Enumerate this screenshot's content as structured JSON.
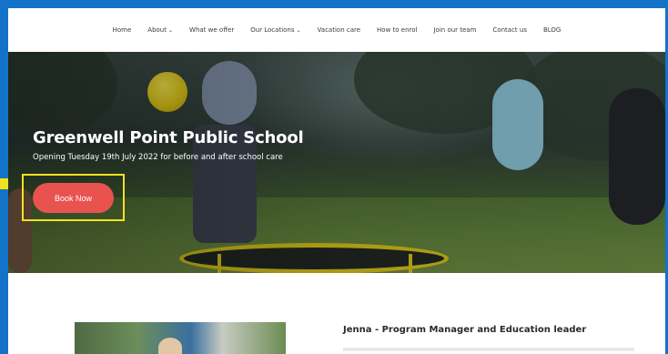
{
  "nav": {
    "items": [
      {
        "label": "Home",
        "dropdown": false
      },
      {
        "label": "About",
        "dropdown": true
      },
      {
        "label": "What we offer",
        "dropdown": false
      },
      {
        "label": "Our Locations",
        "dropdown": true
      },
      {
        "label": "Vacation care",
        "dropdown": false
      },
      {
        "label": "How to enrol",
        "dropdown": false
      },
      {
        "label": "Join our team",
        "dropdown": false
      },
      {
        "label": "Contact us",
        "dropdown": false
      },
      {
        "label": "BLOG",
        "dropdown": false
      }
    ],
    "chevron": "⌄"
  },
  "hero": {
    "title": "Greenwell Point Public School",
    "subtitle": "Opening Tuesday 19th July 2022 for before and after school care",
    "cta_label": "Book Now"
  },
  "section": {
    "heading": "Jenna - Program Manager and Education leader"
  },
  "colors": {
    "frame": "#1273c9",
    "cta": "#e8524f",
    "highlight": "#f2e21e"
  }
}
